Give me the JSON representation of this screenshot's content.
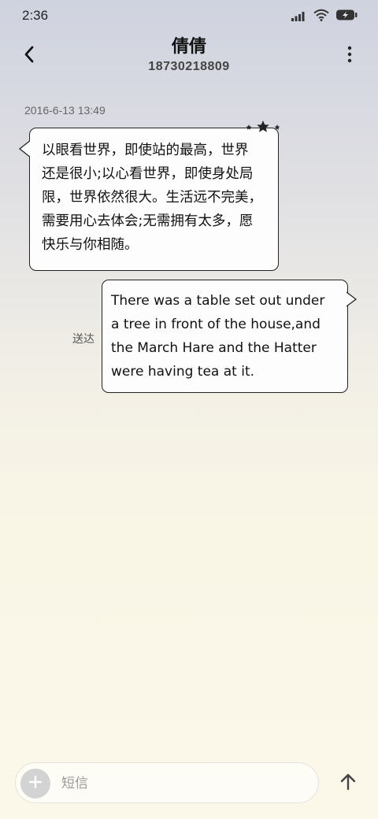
{
  "status_bar": {
    "time": "2:36",
    "icons": [
      "signal-icon",
      "wifi-icon",
      "battery-charging-icon"
    ]
  },
  "header": {
    "contact_name": "倩倩",
    "contact_number": "18730218809",
    "icons": [
      "back-arrow-icon",
      "more-vertical-icon"
    ]
  },
  "conversation": {
    "timestamp": "2016-6-13 13:49",
    "incoming": {
      "lines": [
        "以眼看世界，即使站的最高，世界",
        "还是很小;以心看世界，即使身处局",
        "限，世界依然很大。生活远不完美，",
        "需要用心去体会;无需拥有太多，愿",
        "快乐与你相随。"
      ]
    },
    "outgoing": {
      "lines": [
        "There was a table set out under",
        "a tree in front of the house,and",
        "the March Hare and the Hatter",
        "were having tea at it."
      ],
      "status": "送达"
    }
  },
  "composer": {
    "placeholder": "短信",
    "icons": [
      "add-icon",
      "send-arrow-up-icon"
    ]
  },
  "colors": {
    "bubble_fill": "#fdfdfd",
    "bubble_border": "#222222",
    "timestamp": "#666666",
    "accent_gray": "#d3d3d3"
  }
}
